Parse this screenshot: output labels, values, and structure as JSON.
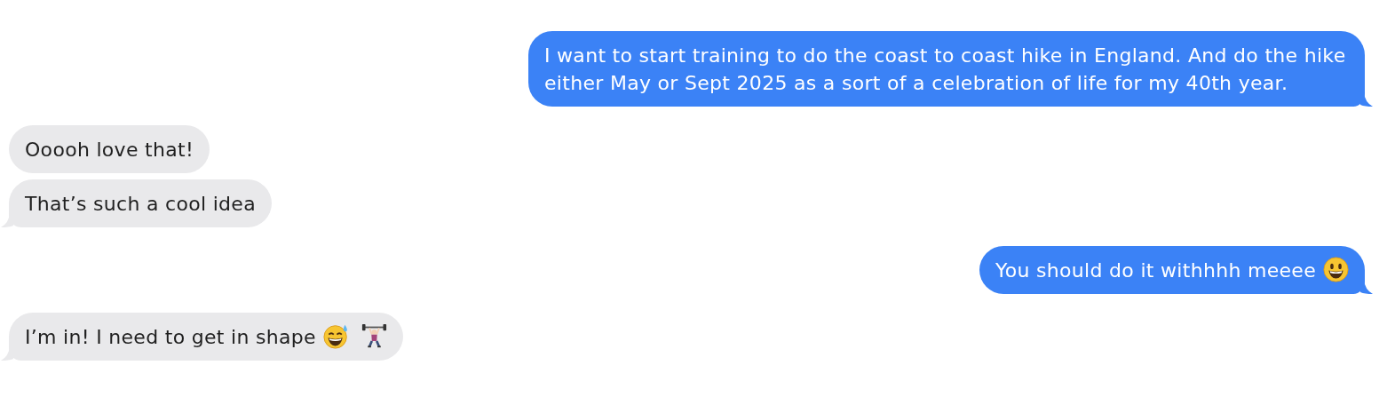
{
  "messages": [
    {
      "outgoing": true,
      "tail": true,
      "text": "I want to start training to do the coast to coast hike in England. And do the hike either May or Sept 2025 as a sort of a celebration of life for my 40th year."
    },
    {
      "outgoing": false,
      "tail": false,
      "text": "Ooooh love that!"
    },
    {
      "outgoing": false,
      "tail": true,
      "text": "That’s such a cool idea"
    },
    {
      "outgoing": true,
      "tail": true,
      "text": "You should do it withhhh meeee",
      "icons": [
        {
          "kind": "smiley"
        }
      ]
    },
    {
      "outgoing": false,
      "tail": true,
      "text": "I’m in! I need to get in shape",
      "icons": [
        {
          "kind": "sweat-smile"
        },
        {
          "kind": "weightlifter"
        }
      ]
    }
  ]
}
